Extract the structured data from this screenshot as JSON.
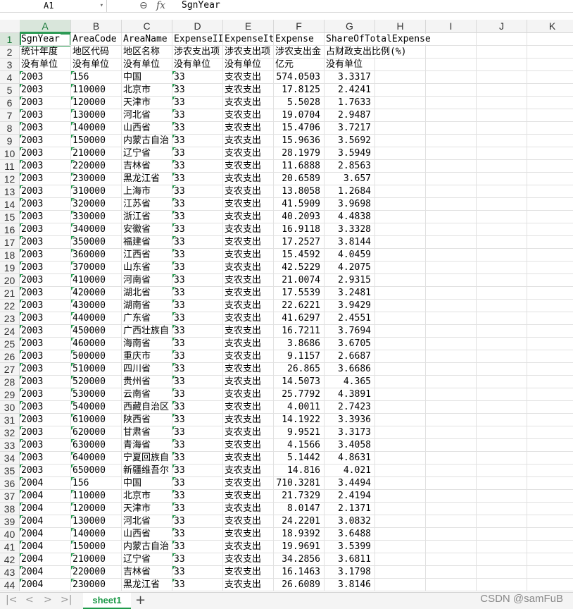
{
  "formula_bar": {
    "name_box": "A1",
    "formula_value": "SgnYear"
  },
  "columns": [
    "A",
    "B",
    "C",
    "D",
    "E",
    "F",
    "G",
    "H",
    "I",
    "J",
    "K"
  ],
  "header_rows": [
    [
      "SgnYear",
      "AreaCode",
      "AreaName",
      "ExpenseIII",
      "ExpenseIt",
      "Expense",
      "ShareOfTotalExpense"
    ],
    [
      "统计年度",
      "地区代码",
      "地区名称",
      "涉农支出项",
      "涉农支出项",
      "涉农支出金",
      "占财政支出比例(%)"
    ],
    [
      "没有单位",
      "没有单位",
      "没有单位",
      "没有单位",
      "没有单位",
      "亿元",
      "没有单位"
    ]
  ],
  "data_rows": [
    [
      "2003",
      "156",
      "中国",
      "33",
      "支农支出",
      "574.0503",
      "3.3317"
    ],
    [
      "2003",
      "110000",
      "北京市",
      "33",
      "支农支出",
      "17.8125",
      "2.4241"
    ],
    [
      "2003",
      "120000",
      "天津市",
      "33",
      "支农支出",
      "5.5028",
      "1.7633"
    ],
    [
      "2003",
      "130000",
      "河北省",
      "33",
      "支农支出",
      "19.0704",
      "2.9487"
    ],
    [
      "2003",
      "140000",
      "山西省",
      "33",
      "支农支出",
      "15.4706",
      "3.7217"
    ],
    [
      "2003",
      "150000",
      "内蒙古自治",
      "33",
      "支农支出",
      "15.9636",
      "3.5692"
    ],
    [
      "2003",
      "210000",
      "辽宁省",
      "33",
      "支农支出",
      "28.1979",
      "3.5949"
    ],
    [
      "2003",
      "220000",
      "吉林省",
      "33",
      "支农支出",
      "11.6888",
      "2.8563"
    ],
    [
      "2003",
      "230000",
      "黑龙江省",
      "33",
      "支农支出",
      "20.6589",
      "3.657"
    ],
    [
      "2003",
      "310000",
      "上海市",
      "33",
      "支农支出",
      "13.8058",
      "1.2684"
    ],
    [
      "2003",
      "320000",
      "江苏省",
      "33",
      "支农支出",
      "41.5909",
      "3.9698"
    ],
    [
      "2003",
      "330000",
      "浙江省",
      "33",
      "支农支出",
      "40.2093",
      "4.4838"
    ],
    [
      "2003",
      "340000",
      "安徽省",
      "33",
      "支农支出",
      "16.9118",
      "3.3328"
    ],
    [
      "2003",
      "350000",
      "福建省",
      "33",
      "支农支出",
      "17.2527",
      "3.8144"
    ],
    [
      "2003",
      "360000",
      "江西省",
      "33",
      "支农支出",
      "15.4592",
      "4.0459"
    ],
    [
      "2003",
      "370000",
      "山东省",
      "33",
      "支农支出",
      "42.5229",
      "4.2075"
    ],
    [
      "2003",
      "410000",
      "河南省",
      "33",
      "支农支出",
      "21.0074",
      "2.9315"
    ],
    [
      "2003",
      "420000",
      "湖北省",
      "33",
      "支农支出",
      "17.5539",
      "3.2481"
    ],
    [
      "2003",
      "430000",
      "湖南省",
      "33",
      "支农支出",
      "22.6221",
      "3.9429"
    ],
    [
      "2003",
      "440000",
      "广东省",
      "33",
      "支农支出",
      "41.6297",
      "2.4551"
    ],
    [
      "2003",
      "450000",
      "广西壮族自",
      "33",
      "支农支出",
      "16.7211",
      "3.7694"
    ],
    [
      "2003",
      "460000",
      "海南省",
      "33",
      "支农支出",
      "3.8686",
      "3.6705"
    ],
    [
      "2003",
      "500000",
      "重庆市",
      "33",
      "支农支出",
      "9.1157",
      "2.6687"
    ],
    [
      "2003",
      "510000",
      "四川省",
      "33",
      "支农支出",
      "26.865",
      "3.6686"
    ],
    [
      "2003",
      "520000",
      "贵州省",
      "33",
      "支农支出",
      "14.5073",
      "4.365"
    ],
    [
      "2003",
      "530000",
      "云南省",
      "33",
      "支农支出",
      "25.7792",
      "4.3891"
    ],
    [
      "2003",
      "540000",
      "西藏自治区",
      "33",
      "支农支出",
      "4.0011",
      "2.7423"
    ],
    [
      "2003",
      "610000",
      "陕西省",
      "33",
      "支农支出",
      "14.1922",
      "3.3936"
    ],
    [
      "2003",
      "620000",
      "甘肃省",
      "33",
      "支农支出",
      "9.9521",
      "3.3173"
    ],
    [
      "2003",
      "630000",
      "青海省",
      "33",
      "支农支出",
      "4.1566",
      "3.4058"
    ],
    [
      "2003",
      "640000",
      "宁夏回族自",
      "33",
      "支农支出",
      "5.1442",
      "4.8631"
    ],
    [
      "2003",
      "650000",
      "新疆维吾尔",
      "33",
      "支农支出",
      "14.816",
      "4.021"
    ],
    [
      "2004",
      "156",
      "中国",
      "33",
      "支农支出",
      "710.3281",
      "3.4494"
    ],
    [
      "2004",
      "110000",
      "北京市",
      "33",
      "支农支出",
      "21.7329",
      "2.4194"
    ],
    [
      "2004",
      "120000",
      "天津市",
      "33",
      "支农支出",
      "8.0147",
      "2.1371"
    ],
    [
      "2004",
      "130000",
      "河北省",
      "33",
      "支农支出",
      "24.2201",
      "3.0832"
    ],
    [
      "2004",
      "140000",
      "山西省",
      "33",
      "支农支出",
      "18.9392",
      "3.6488"
    ],
    [
      "2004",
      "150000",
      "内蒙古自治",
      "33",
      "支农支出",
      "19.9691",
      "3.5399"
    ],
    [
      "2004",
      "210000",
      "辽宁省",
      "33",
      "支农支出",
      "34.2856",
      "3.6811"
    ],
    [
      "2004",
      "220000",
      "吉林省",
      "33",
      "支农支出",
      "16.1463",
      "3.1798"
    ],
    [
      "2004",
      "230000",
      "黑龙江省",
      "33",
      "支农支出",
      "26.6089",
      "3.8146"
    ]
  ],
  "sheet_tabs": [
    "sheet1"
  ],
  "watermark": "CSDN @samFuB",
  "colors": {
    "accent": "#1f9a4a",
    "selection": "#2b9a54"
  },
  "icons": [
    "zoom-icon",
    "fx-icon",
    "first-sheet-icon",
    "prev-sheet-icon",
    "next-sheet-icon",
    "last-sheet-icon",
    "add-sheet-icon"
  ]
}
